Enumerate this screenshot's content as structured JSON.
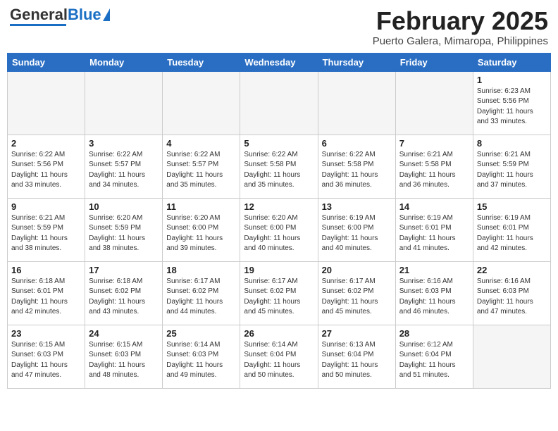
{
  "header": {
    "logo_general": "General",
    "logo_blue": "Blue",
    "month_title": "February 2025",
    "subtitle": "Puerto Galera, Mimaropa, Philippines"
  },
  "columns": [
    "Sunday",
    "Monday",
    "Tuesday",
    "Wednesday",
    "Thursday",
    "Friday",
    "Saturday"
  ],
  "weeks": [
    [
      {
        "day": "",
        "info": ""
      },
      {
        "day": "",
        "info": ""
      },
      {
        "day": "",
        "info": ""
      },
      {
        "day": "",
        "info": ""
      },
      {
        "day": "",
        "info": ""
      },
      {
        "day": "",
        "info": ""
      },
      {
        "day": "1",
        "info": "Sunrise: 6:23 AM\nSunset: 5:56 PM\nDaylight: 11 hours\nand 33 minutes."
      }
    ],
    [
      {
        "day": "2",
        "info": "Sunrise: 6:22 AM\nSunset: 5:56 PM\nDaylight: 11 hours\nand 33 minutes."
      },
      {
        "day": "3",
        "info": "Sunrise: 6:22 AM\nSunset: 5:57 PM\nDaylight: 11 hours\nand 34 minutes."
      },
      {
        "day": "4",
        "info": "Sunrise: 6:22 AM\nSunset: 5:57 PM\nDaylight: 11 hours\nand 35 minutes."
      },
      {
        "day": "5",
        "info": "Sunrise: 6:22 AM\nSunset: 5:58 PM\nDaylight: 11 hours\nand 35 minutes."
      },
      {
        "day": "6",
        "info": "Sunrise: 6:22 AM\nSunset: 5:58 PM\nDaylight: 11 hours\nand 36 minutes."
      },
      {
        "day": "7",
        "info": "Sunrise: 6:21 AM\nSunset: 5:58 PM\nDaylight: 11 hours\nand 36 minutes."
      },
      {
        "day": "8",
        "info": "Sunrise: 6:21 AM\nSunset: 5:59 PM\nDaylight: 11 hours\nand 37 minutes."
      }
    ],
    [
      {
        "day": "9",
        "info": "Sunrise: 6:21 AM\nSunset: 5:59 PM\nDaylight: 11 hours\nand 38 minutes."
      },
      {
        "day": "10",
        "info": "Sunrise: 6:20 AM\nSunset: 5:59 PM\nDaylight: 11 hours\nand 38 minutes."
      },
      {
        "day": "11",
        "info": "Sunrise: 6:20 AM\nSunset: 6:00 PM\nDaylight: 11 hours\nand 39 minutes."
      },
      {
        "day": "12",
        "info": "Sunrise: 6:20 AM\nSunset: 6:00 PM\nDaylight: 11 hours\nand 40 minutes."
      },
      {
        "day": "13",
        "info": "Sunrise: 6:19 AM\nSunset: 6:00 PM\nDaylight: 11 hours\nand 40 minutes."
      },
      {
        "day": "14",
        "info": "Sunrise: 6:19 AM\nSunset: 6:01 PM\nDaylight: 11 hours\nand 41 minutes."
      },
      {
        "day": "15",
        "info": "Sunrise: 6:19 AM\nSunset: 6:01 PM\nDaylight: 11 hours\nand 42 minutes."
      }
    ],
    [
      {
        "day": "16",
        "info": "Sunrise: 6:18 AM\nSunset: 6:01 PM\nDaylight: 11 hours\nand 42 minutes."
      },
      {
        "day": "17",
        "info": "Sunrise: 6:18 AM\nSunset: 6:02 PM\nDaylight: 11 hours\nand 43 minutes."
      },
      {
        "day": "18",
        "info": "Sunrise: 6:17 AM\nSunset: 6:02 PM\nDaylight: 11 hours\nand 44 minutes."
      },
      {
        "day": "19",
        "info": "Sunrise: 6:17 AM\nSunset: 6:02 PM\nDaylight: 11 hours\nand 45 minutes."
      },
      {
        "day": "20",
        "info": "Sunrise: 6:17 AM\nSunset: 6:02 PM\nDaylight: 11 hours\nand 45 minutes."
      },
      {
        "day": "21",
        "info": "Sunrise: 6:16 AM\nSunset: 6:03 PM\nDaylight: 11 hours\nand 46 minutes."
      },
      {
        "day": "22",
        "info": "Sunrise: 6:16 AM\nSunset: 6:03 PM\nDaylight: 11 hours\nand 47 minutes."
      }
    ],
    [
      {
        "day": "23",
        "info": "Sunrise: 6:15 AM\nSunset: 6:03 PM\nDaylight: 11 hours\nand 47 minutes."
      },
      {
        "day": "24",
        "info": "Sunrise: 6:15 AM\nSunset: 6:03 PM\nDaylight: 11 hours\nand 48 minutes."
      },
      {
        "day": "25",
        "info": "Sunrise: 6:14 AM\nSunset: 6:03 PM\nDaylight: 11 hours\nand 49 minutes."
      },
      {
        "day": "26",
        "info": "Sunrise: 6:14 AM\nSunset: 6:04 PM\nDaylight: 11 hours\nand 50 minutes."
      },
      {
        "day": "27",
        "info": "Sunrise: 6:13 AM\nSunset: 6:04 PM\nDaylight: 11 hours\nand 50 minutes."
      },
      {
        "day": "28",
        "info": "Sunrise: 6:12 AM\nSunset: 6:04 PM\nDaylight: 11 hours\nand 51 minutes."
      },
      {
        "day": "",
        "info": ""
      }
    ]
  ]
}
